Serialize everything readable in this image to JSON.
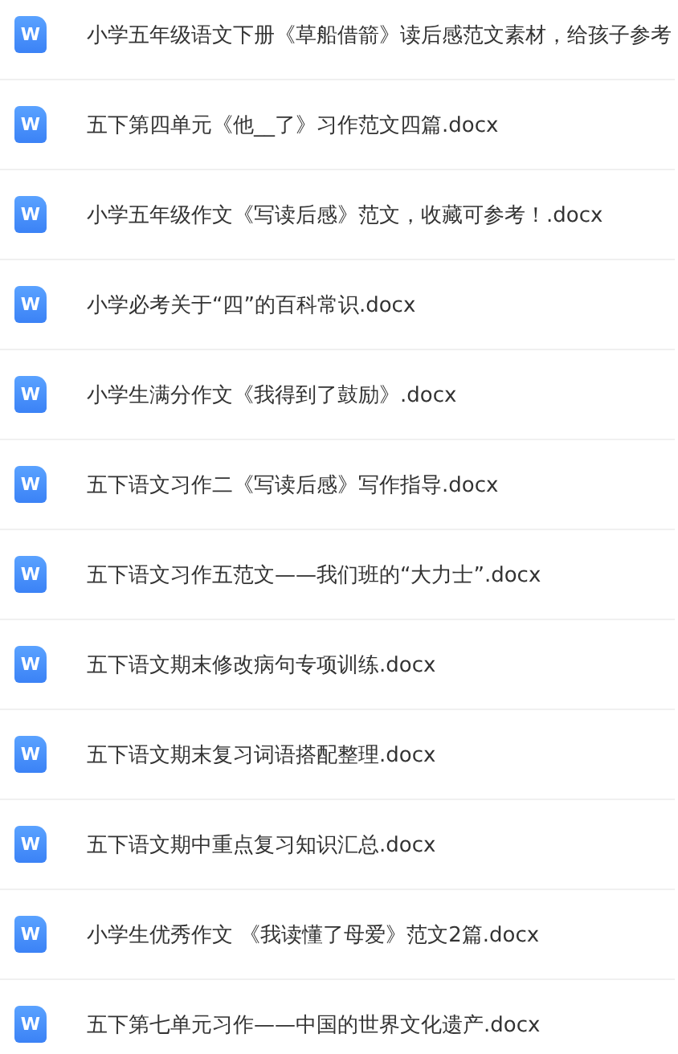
{
  "files": [
    {
      "icon_label": "W",
      "name": "小学五年级语文下册《草船借箭》读后感范文素材，给孩子参考"
    },
    {
      "icon_label": "W",
      "name": "五下第四单元《他__了》习作范文四篇.docx"
    },
    {
      "icon_label": "W",
      "name": "小学五年级作文《写读后感》范文，收藏可参考！.docx"
    },
    {
      "icon_label": "W",
      "name": "小学必考关于“四”的百科常识.docx"
    },
    {
      "icon_label": "W",
      "name": "小学生满分作文《我得到了鼓励》.docx"
    },
    {
      "icon_label": "W",
      "name": "五下语文习作二《写读后感》写作指导.docx"
    },
    {
      "icon_label": "W",
      "name": "五下语文习作五范文——我们班的“大力士”.docx"
    },
    {
      "icon_label": "W",
      "name": "五下语文期末修改病句专项训练.docx"
    },
    {
      "icon_label": "W",
      "name": "五下语文期末复习词语搭配整理.docx"
    },
    {
      "icon_label": "W",
      "name": "五下语文期中重点复习知识汇总.docx"
    },
    {
      "icon_label": "W",
      "name": "小学生优秀作文 《我读懂了母爱》范文2篇.docx"
    },
    {
      "icon_label": "W",
      "name": "五下第七单元习作——中国的世界文化遗产.docx"
    }
  ]
}
